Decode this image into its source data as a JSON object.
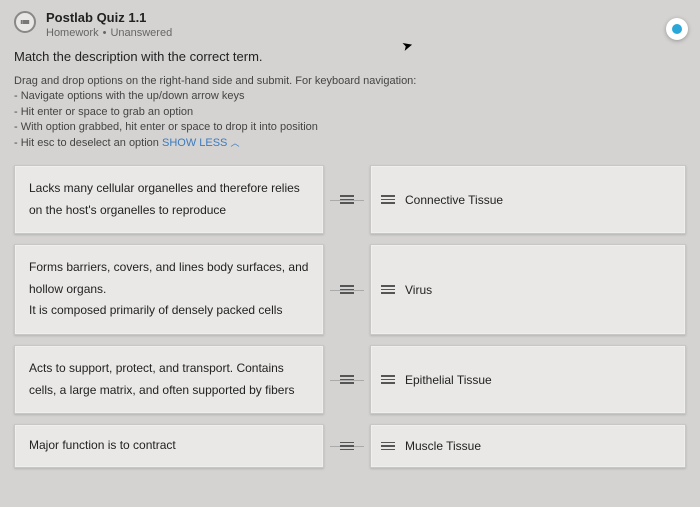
{
  "header": {
    "title": "Postlab Quiz 1.1",
    "category": "Homework",
    "status": "Unanswered"
  },
  "prompt": "Match the description with the correct term.",
  "instructions": {
    "intro": "Drag and drop options on the right-hand side and submit. For keyboard navigation:",
    "line1": "- Navigate options with the up/down arrow keys",
    "line2": "- Hit enter or space to grab an option",
    "line3": "- With option grabbed, hit enter or space to drop it into position",
    "line4": "- Hit esc to deselect an option",
    "toggle": "SHOW LESS"
  },
  "rows": [
    {
      "desc": "Lacks many cellular organelles and therefore relies on the host's organelles to reproduce",
      "term": "Connective Tissue"
    },
    {
      "desc": "Forms barriers, covers, and lines body surfaces, and hollow organs.\nIt is composed primarily of densely packed cells",
      "term": "Virus"
    },
    {
      "desc": "Acts to support, protect, and transport. Contains cells, a large matrix, and often supported by fibers",
      "term": "Epithelial Tissue"
    },
    {
      "desc": "Major function is to contract",
      "term": "Muscle Tissue"
    }
  ]
}
